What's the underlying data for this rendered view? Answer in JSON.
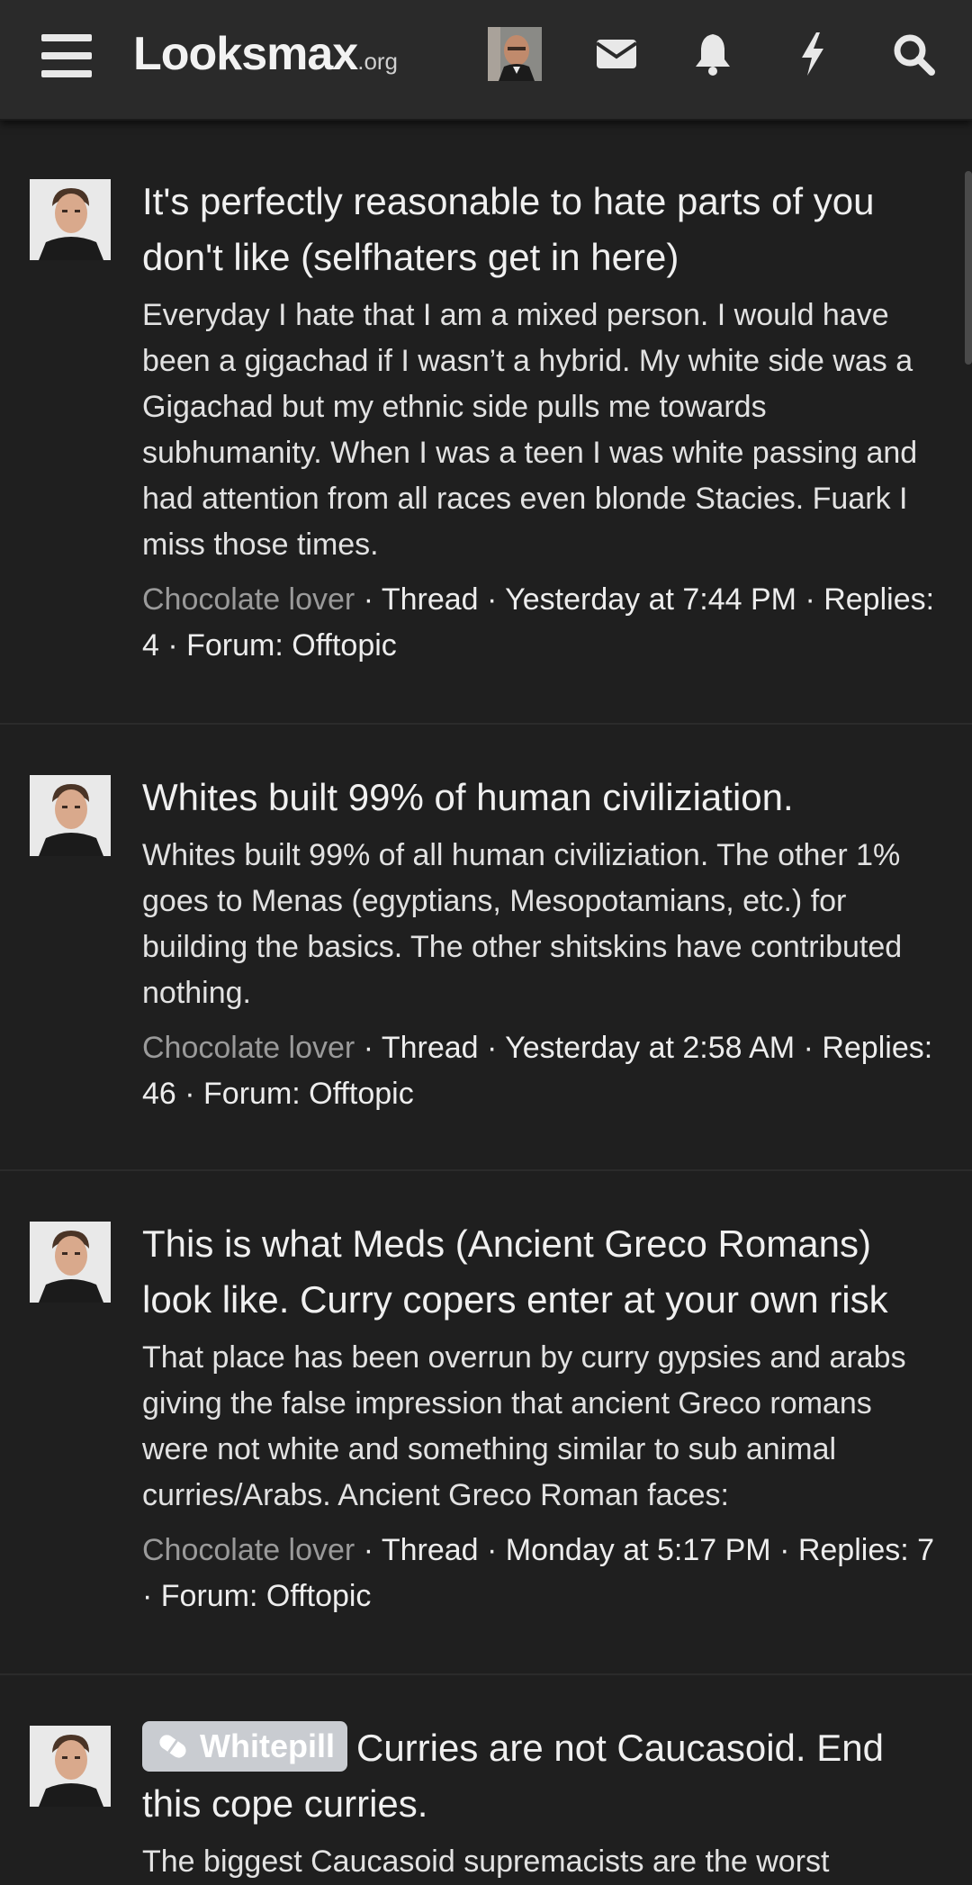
{
  "header": {
    "menu_icon": "hamburger-menu-icon",
    "logo_main": "Looksmax",
    "logo_tld": ".org",
    "icons": [
      "user-avatar",
      "envelope-icon",
      "bell-icon",
      "lightning-icon",
      "search-icon"
    ]
  },
  "results": [
    {
      "title": "It's perfectly reasonable to hate parts of you don't like (selfhaters get in here)",
      "snippet": "Everyday I hate that I am a mixed person. I would have been a gigachad if I wasn’t a hybrid. My white side was a Gigachad but my ethnic side pulls me towards subhumanity. When I was a teen I was white passing and had attention from all races even blonde Stacies. Fuark I miss those times.",
      "author": "Chocolate lover",
      "meta_rest": " · Thread · Yesterday at 7:44 PM · Replies: 4 · Forum: Offtopic"
    },
    {
      "title": "Whites built 99% of human civiliziation.",
      "snippet": "Whites built 99% of all human civiliziation. The other 1% goes to Menas (egyptians, Mesopotamians, etc.) for building the basics. The other shitskins have contributed nothing.",
      "author": "Chocolate lover",
      "meta_rest": " · Thread · Yesterday at 2:58 AM · Replies: 46 · Forum: Offtopic"
    },
    {
      "title": "This is what Meds (Ancient Greco Romans) look like. Curry copers enter at your own risk",
      "snippet": "That place has been overrun by curry gypsies and arabs giving the false impression that ancient Greco romans were not white and something similar to sub animal curries/Arabs. Ancient Greco Roman faces:",
      "author": "Chocolate lover",
      "meta_rest": " · Thread · Monday at 5:17 PM · Replies: 7 · Forum: Offtopic"
    },
    {
      "prefix": "Whitepill",
      "title": "Curries are not Caucasoid. End this cope curries.",
      "snippet": "The biggest Caucasoid supremacists are the worst"
    }
  ]
}
